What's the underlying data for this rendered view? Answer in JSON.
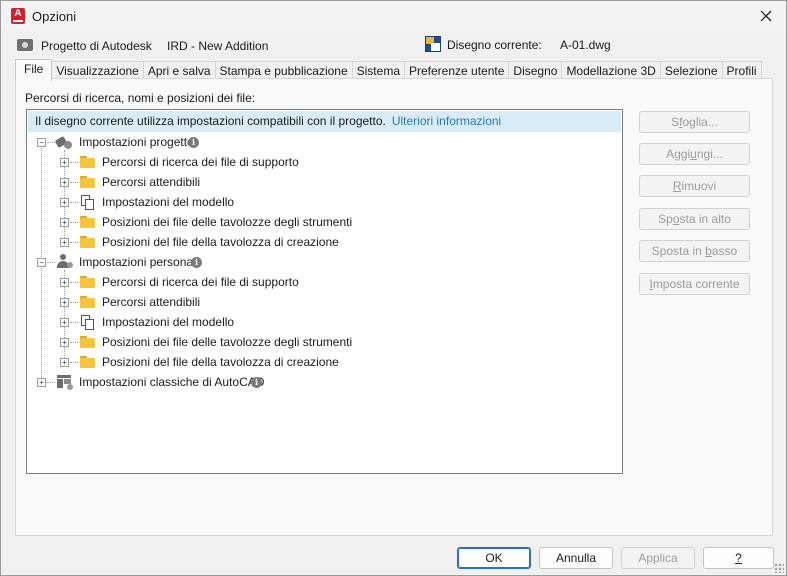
{
  "window": {
    "title": "Opzioni",
    "app_icon_letter": "A"
  },
  "info": {
    "project_label": "Progetto di Autodesk",
    "project_value": "IRD - New Addition",
    "drawing_label": "Disegno corrente:",
    "drawing_value": "A-01.dwg"
  },
  "tabs": [
    {
      "label": "File",
      "active": true
    },
    {
      "label": "Visualizzazione"
    },
    {
      "label": "Apri e salva"
    },
    {
      "label": "Stampa e pubblicazione"
    },
    {
      "label": "Sistema"
    },
    {
      "label": "Preferenze utente"
    },
    {
      "label": "Disegno"
    },
    {
      "label": "Modellazione 3D"
    },
    {
      "label": "Selezione"
    },
    {
      "label": "Profili"
    }
  ],
  "panel_label": "Percorsi di ricerca, nomi e posizioni dei file:",
  "banner": {
    "text": "Il disegno corrente utilizza impostazioni compatibili con il progetto.",
    "link": "Ulteriori informazioni"
  },
  "tree": {
    "project_group": {
      "label": "Impostazioni progetto",
      "children": [
        "Percorsi di ricerca dei file di supporto",
        "Percorsi attendibili",
        "Impostazioni del modello",
        "Posizioni dei file delle tavolozze degli strumenti",
        "Posizioni del file della tavolozza di creazione"
      ]
    },
    "personal_group": {
      "label": "Impostazioni personali",
      "children": [
        "Percorsi di ricerca dei file di supporto",
        "Percorsi attendibili",
        "Impostazioni del modello",
        "Posizioni dei file delle tavolozze degli strumenti",
        "Posizioni del file della tavolozza di creazione"
      ]
    },
    "classic_group": {
      "label": "Impostazioni classiche di AutoCAD"
    }
  },
  "side_buttons": {
    "browse": {
      "pre": "S",
      "u": "f",
      "post": "oglia..."
    },
    "add": {
      "pre": "Aggi",
      "u": "u",
      "post": "ngi..."
    },
    "remove": {
      "pre": "",
      "u": "R",
      "post": "imuovi"
    },
    "move_up": {
      "pre": "Sp",
      "u": "o",
      "post": "sta in alto"
    },
    "move_down": {
      "pre": "Sposta in ",
      "u": "b",
      "post": "asso"
    },
    "set_current": {
      "pre": "",
      "u": "I",
      "post": "mposta corrente"
    }
  },
  "bottom_buttons": {
    "ok": "OK",
    "cancel": "Annulla",
    "apply": "Applica",
    "help": "?"
  },
  "icons": {
    "close": "close-icon",
    "info": "i"
  }
}
